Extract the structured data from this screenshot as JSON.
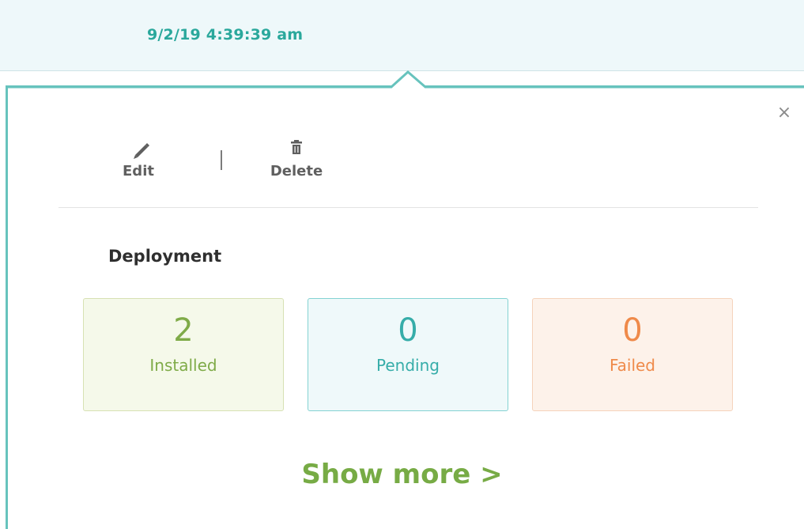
{
  "row": {
    "timestamp": "9/2/19 4:39:39 am"
  },
  "panel": {
    "close_label": "×",
    "actions": {
      "edit_label": "Edit",
      "delete_label": "Delete",
      "separator": "|"
    },
    "deployment": {
      "title": "Deployment",
      "stats": [
        {
          "count": "2",
          "label": "Installed",
          "color": "#7fab48"
        },
        {
          "count": "0",
          "label": "Pending",
          "color": "#36ada9"
        },
        {
          "count": "0",
          "label": "Failed",
          "color": "#ef8a4a"
        }
      ]
    },
    "show_more_label": "Show more >"
  },
  "icons": {
    "edit": "pencil-icon",
    "delete": "trash-icon",
    "close": "close-icon"
  },
  "colors": {
    "accent": "#67c3bd",
    "timestamp": "#2aa89c",
    "show_more": "#77ab45"
  }
}
